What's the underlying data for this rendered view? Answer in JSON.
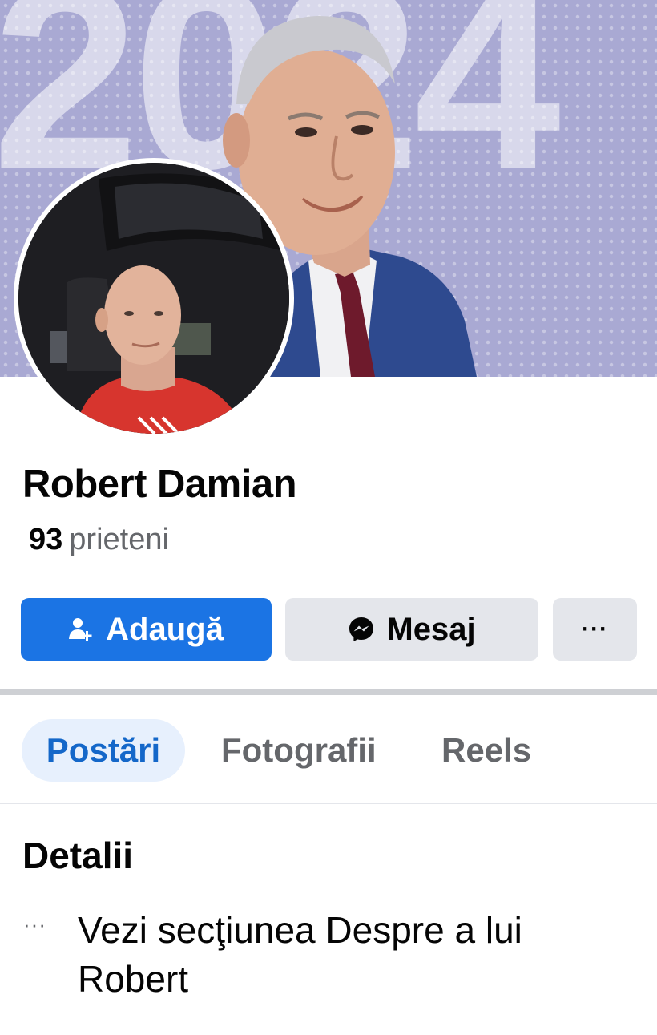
{
  "cover": {
    "year_text": "2024"
  },
  "profile": {
    "name": "Robert Damian",
    "friends_count": "93",
    "friends_label": "prieteni"
  },
  "actions": {
    "add_label": "Adaugă",
    "message_label": "Mesaj",
    "more_label": "···"
  },
  "tabs": [
    {
      "label": "Postări",
      "active": true
    },
    {
      "label": "Fotografii",
      "active": false
    },
    {
      "label": "Reels",
      "active": false
    }
  ],
  "details": {
    "title": "Detalii",
    "more_icon": "···",
    "about_text": "Vezi secţiunea Despre a lui Robert"
  },
  "colors": {
    "primary": "#1b74e4",
    "tab_active_bg": "#e7f0fd",
    "tab_active_text": "#1467c9",
    "secondary_button": "#e4e6eb",
    "muted_text": "#65676b",
    "cover_bg": "#a9a9d3"
  },
  "icons": {
    "add_friend": "add-friend-icon",
    "messenger": "messenger-icon",
    "more": "more-icon"
  }
}
